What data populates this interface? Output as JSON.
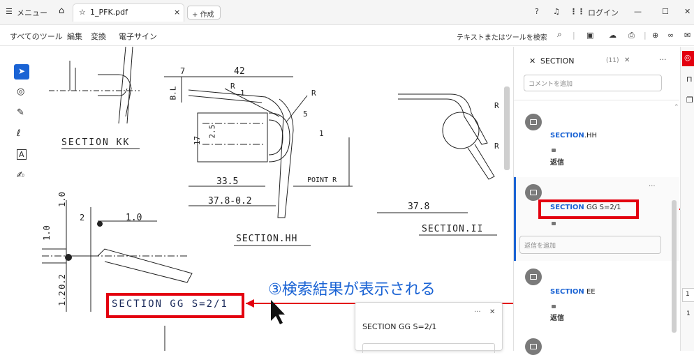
{
  "titlebar": {
    "menu_label": "メニュー",
    "tab_title": "1_PFK.pdf",
    "tab_close": "×",
    "new_tab_label": "作成",
    "login_label": "ログイン",
    "minimize": "—",
    "maximize": "☐",
    "close": "✕"
  },
  "menubar": {
    "items": [
      "すべてのツール",
      "編集",
      "変換",
      "電子サイン"
    ],
    "search_placeholder": "テキストまたはツールを検索"
  },
  "drawing": {
    "section_kk": "SECTION KK",
    "section_hh": "SECTION.HH",
    "section_ii": "SECTION.II",
    "section_gg": "SECTION GG S=2/1",
    "point_r": "POINT R",
    "dims": {
      "d42": "42",
      "d7": "7",
      "d33_5": "33.5",
      "d37_8_tol": "37.8-0.2",
      "d37_8": "37.8",
      "d17": "17",
      "d2_5": "2.5",
      "d1_0a": "1.0",
      "d1_0b": "1.0",
      "d1_0c": "1.0",
      "d2": "2",
      "d1_2": "1.2",
      "d0_2": "0.2",
      "bl": "B.L",
      "r": "R",
      "r1": "1",
      "r5": "5"
    }
  },
  "annotation": {
    "text": "③検索結果が表示される",
    "color": "#1a63d4",
    "box_color": "#e3000f"
  },
  "popup": {
    "title": "SECTION GG S=2/1",
    "more": "···",
    "close": "✕"
  },
  "panel": {
    "search_term": "SECTION",
    "result_count": "(11)",
    "more": "···",
    "comment_placeholder": "コメントを追加",
    "reply_placeholder": "返信を追加",
    "comments": [
      {
        "keyword": "SECTION",
        "rest": ".HH",
        "reply": "返信"
      },
      {
        "keyword": "SECTION",
        "rest": " GG S=2/1",
        "reply": ""
      },
      {
        "keyword": "SECTION",
        "rest": " EE",
        "reply": "返信"
      }
    ]
  },
  "right_strip": {
    "page_number": "1"
  }
}
